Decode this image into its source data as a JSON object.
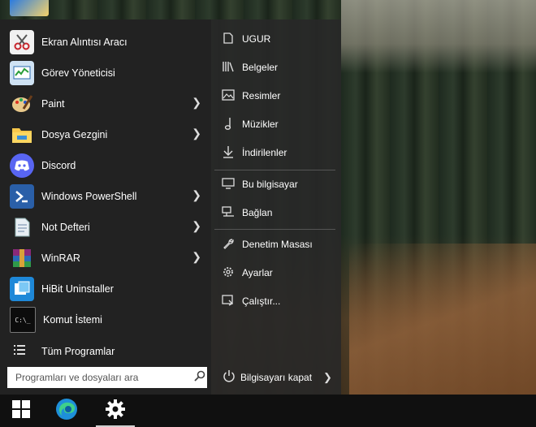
{
  "start_menu": {
    "apps": [
      {
        "label": "Ekran Alıntısı Aracı",
        "icon": "scissors-icon",
        "has_submenu": false
      },
      {
        "label": "Görev Yöneticisi",
        "icon": "task-manager-icon",
        "has_submenu": false
      },
      {
        "label": "Paint",
        "icon": "paint-palette-icon",
        "has_submenu": true
      },
      {
        "label": "Dosya Gezgini",
        "icon": "folder-icon",
        "has_submenu": true
      },
      {
        "label": "Discord",
        "icon": "discord-icon",
        "has_submenu": false
      },
      {
        "label": "Windows PowerShell",
        "icon": "powershell-icon",
        "has_submenu": true
      },
      {
        "label": "Not Defteri",
        "icon": "notepad-icon",
        "has_submenu": true
      },
      {
        "label": "WinRAR",
        "icon": "winrar-icon",
        "has_submenu": true
      },
      {
        "label": "HiBit Uninstaller",
        "icon": "hibit-icon",
        "has_submenu": false
      },
      {
        "label": "Komut İstemi",
        "icon": "command-prompt-icon",
        "has_submenu": false
      }
    ],
    "all_programs": "Tüm Programlar",
    "search_placeholder": "Programları ve dosyaları ara",
    "places": [
      {
        "label": "UGUR",
        "icon": "user-icon"
      },
      {
        "label": "Belgeler",
        "icon": "documents-icon"
      },
      {
        "label": "Resimler",
        "icon": "pictures-icon"
      },
      {
        "label": "Müzikler",
        "icon": "music-icon"
      },
      {
        "label": "İndirilenler",
        "icon": "downloads-icon"
      },
      {
        "label": "Bu bilgisayar",
        "icon": "computer-icon"
      },
      {
        "label": "Bağlan",
        "icon": "connect-icon"
      },
      {
        "label": "Denetim Masası",
        "icon": "wrench-icon"
      },
      {
        "label": "Ayarlar",
        "icon": "gear-icon"
      },
      {
        "label": "Çalıştır...",
        "icon": "run-icon"
      }
    ],
    "shutdown_label": "Bilgisayarı kapat"
  },
  "taskbar": {
    "items": [
      "windows-start-icon",
      "edge-icon",
      "settings-gear-icon"
    ],
    "active_item": "settings-gear-icon"
  },
  "colors": {
    "menu_bg": "#282828",
    "taskbar_bg": "#101010",
    "discord": "#5865F2",
    "powershell": "#2a5fa8"
  }
}
